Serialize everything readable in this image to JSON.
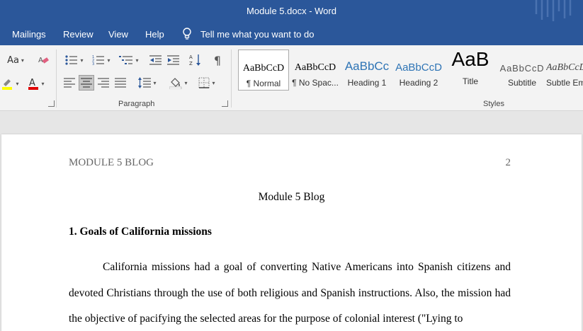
{
  "window": {
    "title": "Module 5.docx  -  Word"
  },
  "menu": {
    "tabs": [
      "Mailings",
      "Review",
      "View",
      "Help"
    ],
    "tell_me": "Tell me what you want to do"
  },
  "ribbon": {
    "font_group": {
      "change_case": "Aa"
    },
    "paragraph_label": "Paragraph",
    "styles_label": "Styles",
    "styles": [
      {
        "sample": "AaBbCcD",
        "name": "¶ Normal"
      },
      {
        "sample": "AaBbCcD",
        "name": "¶ No Spac..."
      },
      {
        "sample": "AaBbCc",
        "name": "Heading 1"
      },
      {
        "sample": "AaBbCcD",
        "name": "Heading 2"
      },
      {
        "sample": "AaB",
        "name": "Title"
      },
      {
        "sample": "AaBbCcD",
        "name": "Subtitle"
      },
      {
        "sample": "AaBbCcD",
        "name": "Subtle Em"
      }
    ],
    "colors": {
      "highlight": "#ffff00",
      "font_color": "#e00000",
      "heading": "#2e74b5"
    }
  },
  "document": {
    "header_left": "MODULE 5 BLOG",
    "page_number": "2",
    "title": "Module 5 Blog",
    "heading1": "1. Goals of California missions",
    "paragraph": "California missions had a goal of converting Native Americans into Spanish citizens and devoted Christians through the use of both religious and Spanish instructions. Also, the mission had the objective of pacifying the selected areas for the purpose of colonial interest (\"Lying to"
  }
}
